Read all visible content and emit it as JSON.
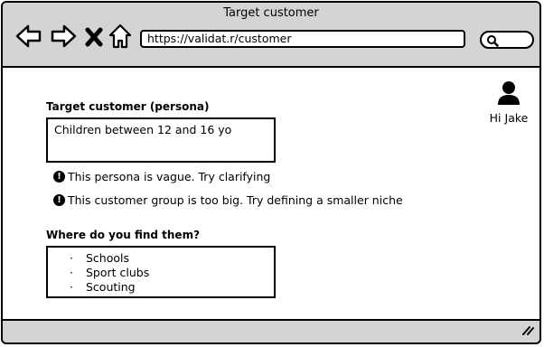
{
  "window": {
    "title": "Target customer"
  },
  "toolbar": {
    "url": "https://validat.r/customer",
    "icons": [
      "back-arrow-icon",
      "forward-arrow-icon",
      "close-x-icon",
      "home-icon",
      "search-icon"
    ]
  },
  "user": {
    "greeting": "Hi Jake",
    "icon": "user-avatar-icon"
  },
  "persona": {
    "label": "Target customer (persona)",
    "value": "Children between 12 and 16 yo",
    "warnings": [
      "This persona is vague. Try clarifying",
      "This customer group is too big. Try defining a smaller niche"
    ]
  },
  "where": {
    "label": "Where do you find them?",
    "items": [
      "Schools",
      "Sport clubs",
      "Scouting"
    ]
  }
}
